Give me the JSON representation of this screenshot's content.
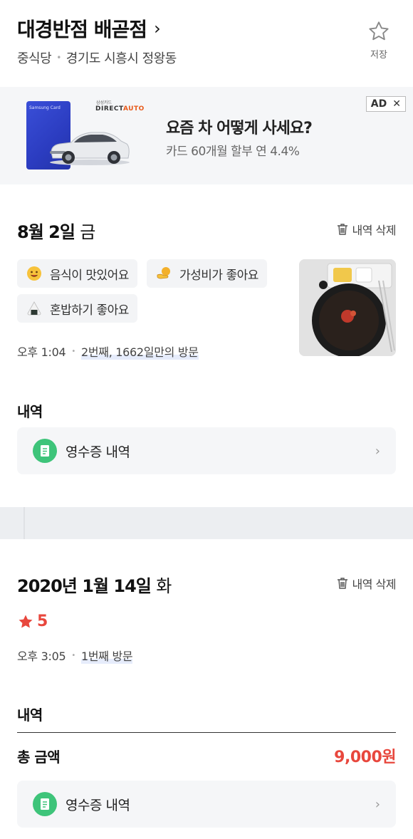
{
  "header": {
    "place_name": "대경반점 배곧점",
    "category": "중식당",
    "location": "경기도 시흥시 정왕동",
    "save_label": "저장"
  },
  "ad": {
    "card_text": "Samsung Card",
    "brand_small": "삼성카드",
    "brand_direct": "DIRECT",
    "brand_auto": "AUTO",
    "headline": "요즘 차 어떻게 사세요?",
    "description": "카드 60개월 할부 연 4.4%",
    "badge_label": "AD",
    "badge_close": "✕"
  },
  "visits": [
    {
      "date": "8월 2일",
      "day_of_week": "금",
      "delete_label": "내역 삭제",
      "tags": [
        {
          "label": "음식이 맛있어요",
          "icon": "smile-emoji-icon"
        },
        {
          "label": "가성비가 좋아요",
          "icon": "coin-hand-emoji-icon"
        },
        {
          "label": "혼밥하기 좋아요",
          "icon": "rice-ball-emoji-icon"
        }
      ],
      "time": "오후 1:04",
      "visit_info": "2번째, 1662일만의 방문",
      "history_label": "내역",
      "receipt_label": "영수증 내역"
    },
    {
      "date": "2020년 1월 14일",
      "day_of_week": "화",
      "delete_label": "내역 삭제",
      "rating": "5",
      "time": "오후 3:05",
      "visit_info": "1번째 방문",
      "history_label": "내역",
      "total_label": "총 금액",
      "total_value": "9,000원",
      "receipt_label": "영수증 내역"
    }
  ],
  "colors": {
    "accent_red": "#e8473d",
    "receipt_green": "#3ec47a",
    "ad_blue": "#2b3cc0"
  }
}
